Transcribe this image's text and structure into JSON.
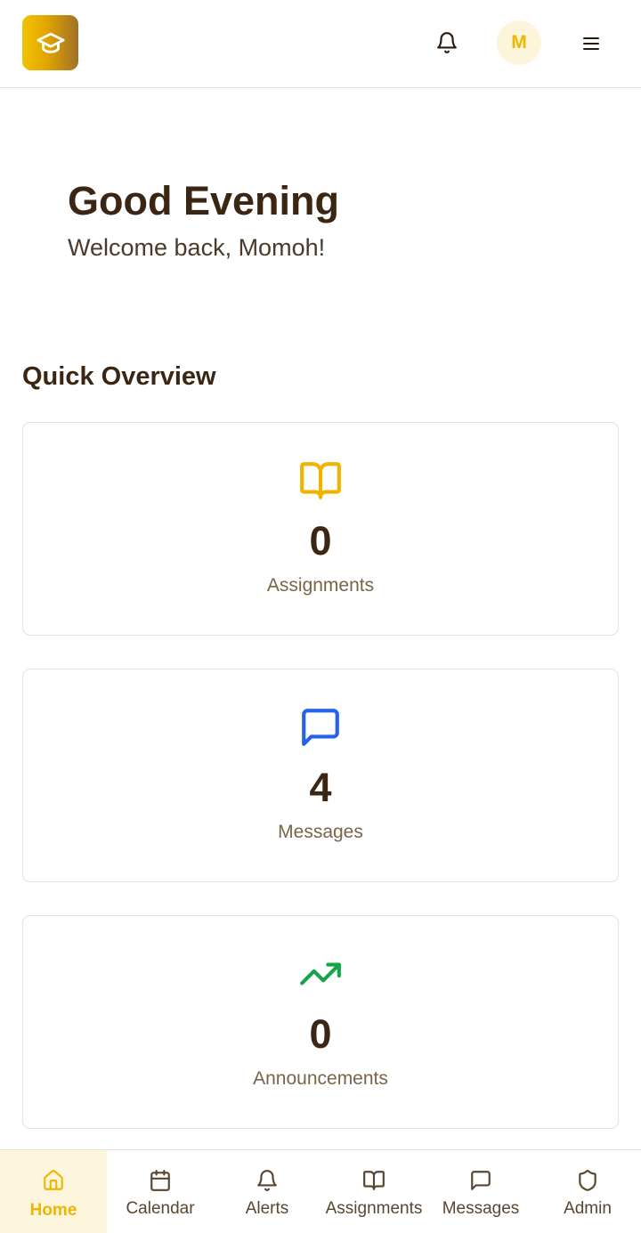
{
  "header": {
    "logo_icon": "graduation-cap-icon",
    "bell_icon": "bell-icon",
    "avatar_initial": "M",
    "menu_icon": "hamburger-menu-icon"
  },
  "greeting": {
    "title": "Good Evening",
    "subtitle": "Welcome back, Momoh!"
  },
  "overview": {
    "title": "Quick Overview",
    "cards": [
      {
        "icon": "book-open-icon",
        "value": "0",
        "label": "Assignments",
        "color": "#f0b400"
      },
      {
        "icon": "message-square-icon",
        "value": "4",
        "label": "Messages",
        "color": "#2563eb"
      },
      {
        "icon": "trending-up-icon",
        "value": "0",
        "label": "Announcements",
        "color": "#16a34a"
      }
    ]
  },
  "bottom_nav": {
    "items": [
      {
        "label": "Home",
        "icon": "home-icon",
        "active": true
      },
      {
        "label": "Calendar",
        "icon": "calendar-icon"
      },
      {
        "label": "Alerts",
        "icon": "bell-icon"
      },
      {
        "label": "Assignments",
        "icon": "book-open-icon"
      },
      {
        "label": "Messages",
        "icon": "message-square-icon"
      },
      {
        "label": "Admin",
        "icon": "shield-icon"
      }
    ]
  },
  "colors": {
    "accent": "#efb600",
    "text_dark": "#3a2612",
    "text_muted": "#7a6448"
  }
}
